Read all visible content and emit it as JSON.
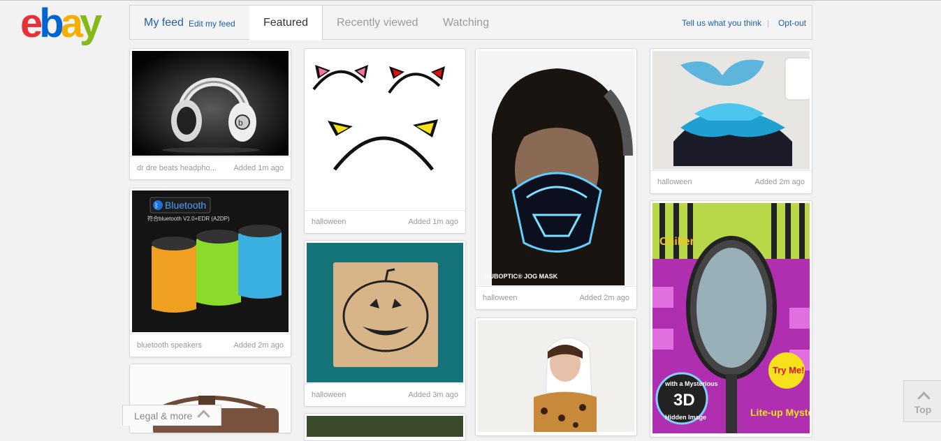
{
  "logo": {
    "letters": [
      "e",
      "b",
      "a",
      "y"
    ],
    "colors": [
      "#e53238",
      "#0064d2",
      "#f5af02",
      "#86b817"
    ]
  },
  "tabs": {
    "my_feed": "My feed",
    "edit_my_feed": "Edit my feed",
    "featured": "Featured",
    "recently_viewed": "Recently viewed",
    "watching": "Watching",
    "active": "Featured"
  },
  "header_links": {
    "tell_us": "Tell us what you think",
    "separator": "|",
    "opt_out": "Opt-out"
  },
  "cards": [
    {
      "title": "dr dre beats headpho...",
      "added": "Added 1m ago"
    },
    {
      "title": "halloween",
      "added": "Added 1m ago"
    },
    {
      "title": "halloween",
      "added": "Added 2m ago"
    },
    {
      "title": "halloween",
      "added": "Added 2m ago"
    },
    {
      "title": "bluetooth speakers",
      "added": "Added 2m ago"
    },
    {
      "title": "halloween",
      "added": "Added 3m ago"
    }
  ],
  "image_captions": {
    "bluetooth_logo": "Bluetooth",
    "bluetooth_spec": "符合bluetooth V2.0+EDR (A2DP)",
    "jog_mask": "HUBOPTIC® JOG MASK",
    "chiller": "Chiller",
    "try_me": "Try Me!",
    "mysterious": "with a Mysterious",
    "three_d": "3D",
    "hidden": "Hidden Image",
    "lite_up": "Lite-up Mystery"
  },
  "footer": {
    "legal": "Legal & more",
    "top": "Top"
  }
}
